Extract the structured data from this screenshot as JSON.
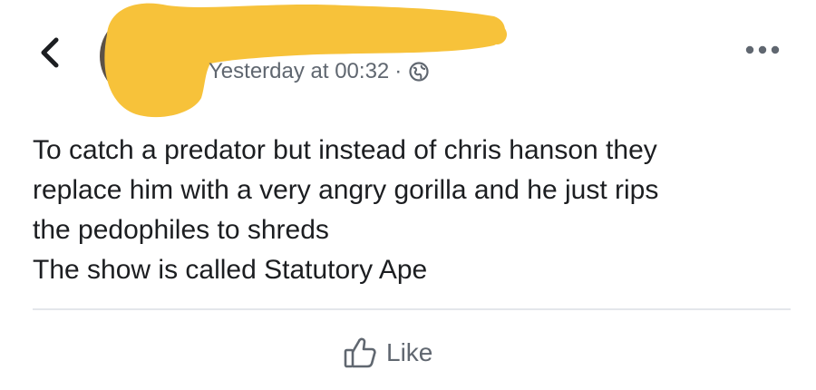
{
  "header": {
    "back_icon": "chevron-left-icon",
    "timestamp": "Yesterday at 00:32",
    "separator": "·",
    "privacy_icon": "globe-icon",
    "more_icon": "more-dots-icon"
  },
  "post": {
    "lines": [
      "To catch a predator but instead of chris hanson they",
      "replace him with a very angry gorilla and he just rips",
      "the pedophiles to shreds",
      "The show is called Statutory Ape"
    ]
  },
  "actions": {
    "like_label": "Like",
    "like_icon": "thumbs-up-icon"
  },
  "colors": {
    "redaction": "#f7c23a",
    "secondary_text": "#606770",
    "primary_text": "#1c1e21",
    "divider": "#e4e6eb"
  }
}
